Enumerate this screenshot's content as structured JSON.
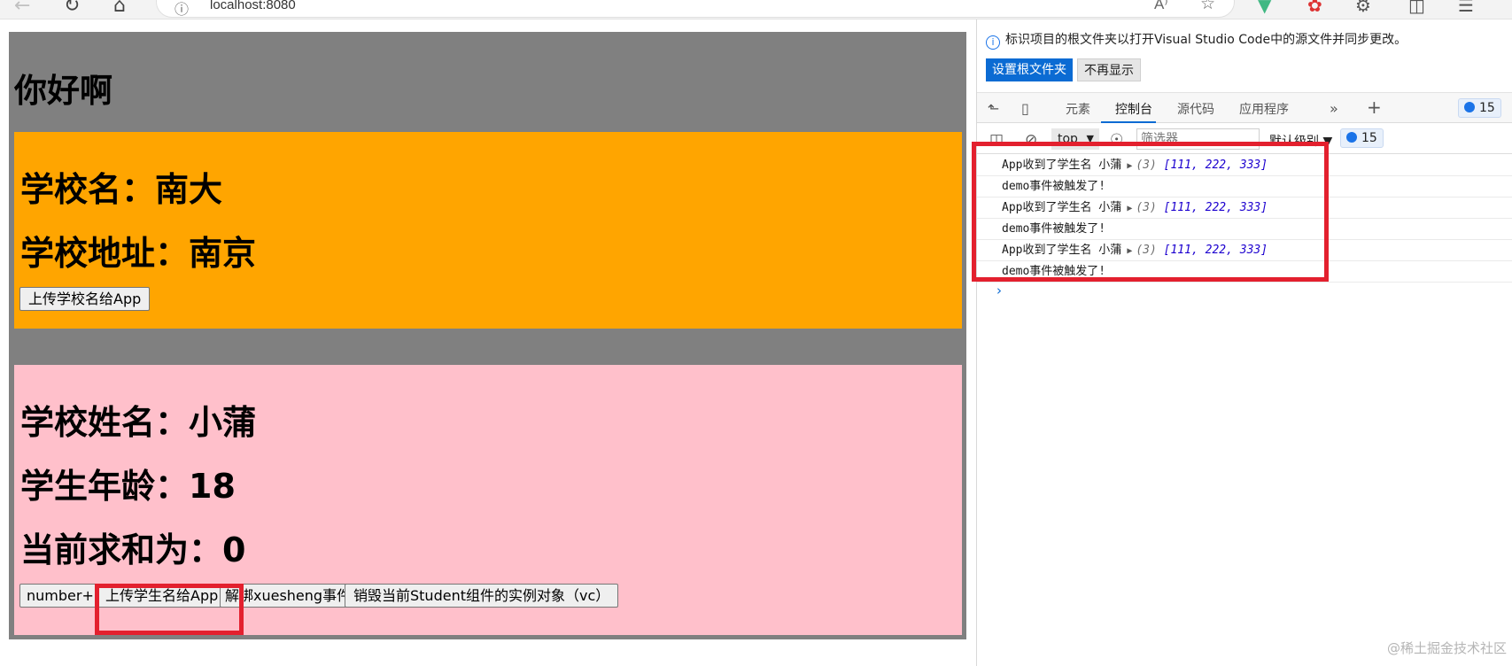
{
  "browser": {
    "url": "localhost:8080",
    "read_aloud_icon": "A⁾"
  },
  "app": {
    "title": "你好啊"
  },
  "school": {
    "name_line": "学校名：南大",
    "address_line": "学校地址：南京",
    "send_button": "上传学校名给App",
    "bg_color": "#ffa500"
  },
  "student": {
    "name_line": "学校姓名：小蒲",
    "age_line": "学生年龄：18",
    "sum_line": "当前求和为：0",
    "buttons": {
      "number": "number++",
      "send_name": "上传学生名给App",
      "unbind": "解绑xuesheng事件",
      "destroy": "销毁当前Student组件的实例对象（vc）"
    },
    "bg_color": "#ffc0cb"
  },
  "devtools": {
    "notice": {
      "text": "标识项目的根文件夹以打开Visual Studio Code中的源文件并同步更改。",
      "primary_button": "设置根文件夹",
      "secondary_button": "不再显示"
    },
    "tabs": [
      "元素",
      "控制台",
      "源代码",
      "应用程序"
    ],
    "active_tab": "控制台",
    "issues_count": "15",
    "context": "top",
    "filter_placeholder": "筛选器",
    "level": "默认级别",
    "console_count": "15",
    "logs": [
      {
        "text": "App收到了学生名 小蒲",
        "count": "(3)",
        "array": "[111, 222, 333]"
      },
      {
        "text": "demo事件被触发了!"
      },
      {
        "text": "App收到了学生名 小蒲",
        "count": "(3)",
        "array": "[111, 222, 333]"
      },
      {
        "text": "demo事件被触发了!"
      },
      {
        "text": "App收到了学生名 小蒲",
        "count": "(3)",
        "array": "[111, 222, 333]"
      },
      {
        "text": "demo事件被触发了!"
      }
    ],
    "prompt": "›"
  },
  "highlight_color": "#e3202e",
  "watermark": "@稀土掘金技术社区"
}
